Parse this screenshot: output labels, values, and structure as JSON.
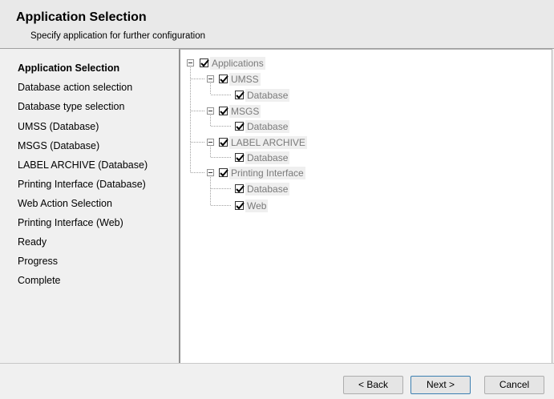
{
  "header": {
    "title": "Application Selection",
    "subtitle": "Specify application for further configuration"
  },
  "steps": [
    {
      "label": "Application Selection",
      "active": true
    },
    {
      "label": "Database action selection"
    },
    {
      "label": "Database type selection"
    },
    {
      "label": "UMSS (Database)"
    },
    {
      "label": "MSGS (Database)"
    },
    {
      "label": "LABEL ARCHIVE (Database)"
    },
    {
      "label": "Printing Interface (Database)"
    },
    {
      "label": "Web Action Selection"
    },
    {
      "label": "Printing Interface (Web)"
    },
    {
      "label": "Ready"
    },
    {
      "label": "Progress"
    },
    {
      "label": "Complete"
    }
  ],
  "tree": {
    "root": {
      "label": "Applications",
      "checked": true
    },
    "nodes": [
      {
        "label": "UMSS",
        "checked": true,
        "children": [
          {
            "label": "Database",
            "checked": true
          }
        ]
      },
      {
        "label": "MSGS",
        "checked": true,
        "children": [
          {
            "label": "Database",
            "checked": true
          }
        ]
      },
      {
        "label": "LABEL ARCHIVE",
        "checked": true,
        "children": [
          {
            "label": "Database",
            "checked": true
          }
        ]
      },
      {
        "label": "Printing Interface",
        "checked": true,
        "children": [
          {
            "label": "Database",
            "checked": true
          },
          {
            "label": "Web",
            "checked": true
          }
        ]
      }
    ]
  },
  "buttons": {
    "back": "< Back",
    "next": "Next >",
    "cancel": "Cancel"
  }
}
